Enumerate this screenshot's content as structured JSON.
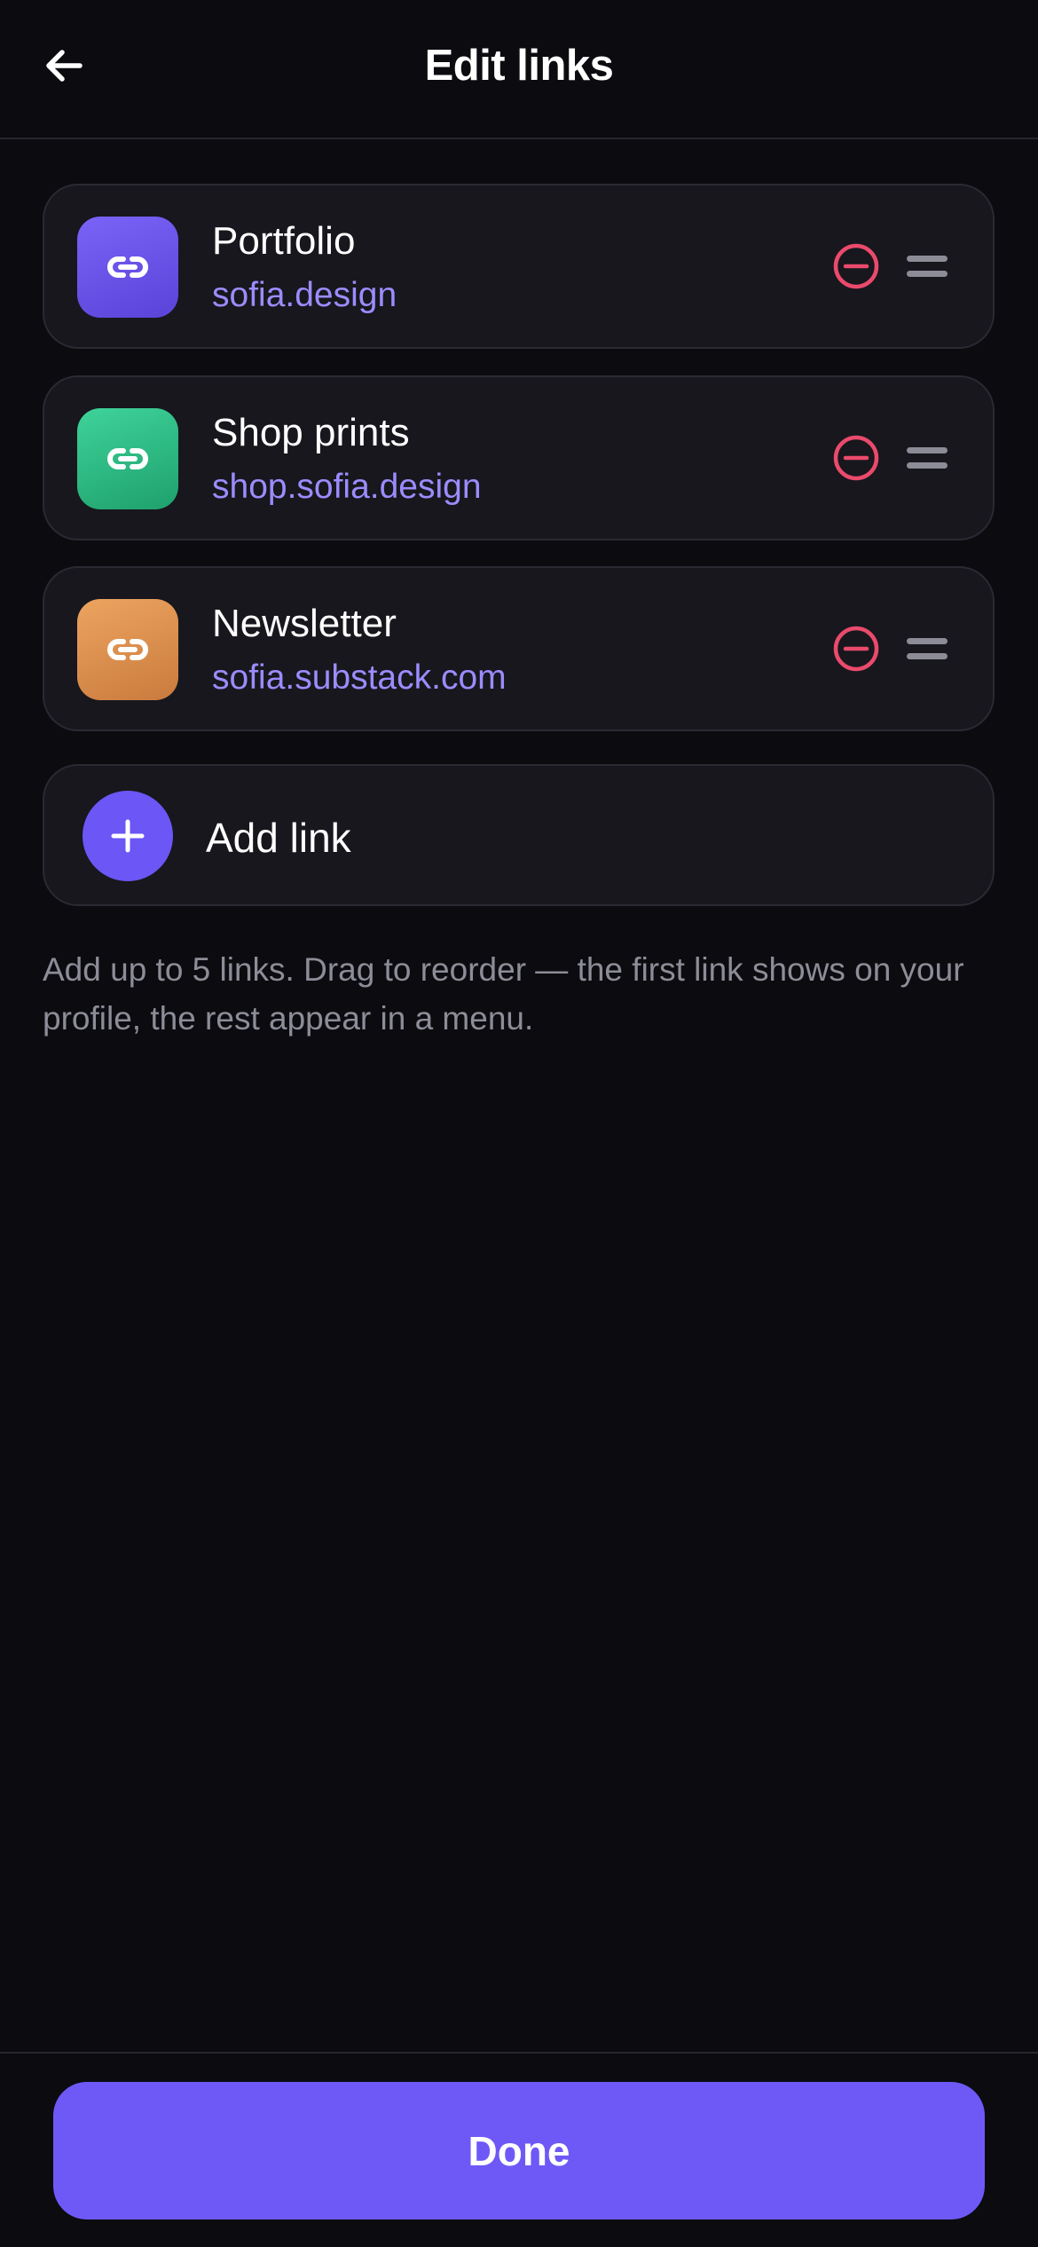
{
  "header": {
    "title": "Edit links",
    "back_icon": "arrow-left-icon"
  },
  "links": [
    {
      "title": "Portfolio",
      "url": "sofia.design",
      "icon": "link-icon",
      "tile_colors": [
        "#7a63f7",
        "#5a43d8"
      ]
    },
    {
      "title": "Shop prints",
      "url": "shop.sofia.design",
      "icon": "link-icon",
      "tile_colors": [
        "#3ed39a",
        "#1fa06c"
      ]
    },
    {
      "title": "Newsletter",
      "url": "sofia.substack.com",
      "icon": "link-icon",
      "tile_colors": [
        "#eda460",
        "#c97b3d"
      ]
    }
  ],
  "add_link": {
    "label": "Add link",
    "icon": "plus-icon"
  },
  "help_text": "Add up to 5 links. Drag to reorder — the first link shows on your profile, the rest appear in a menu.",
  "footer": {
    "done_label": "Done"
  },
  "colors": {
    "background": "#0b0b10",
    "card": "#17171d",
    "accent": "#6e59f7",
    "url_text": "#9b8cff",
    "remove": "#ea4a6c"
  }
}
